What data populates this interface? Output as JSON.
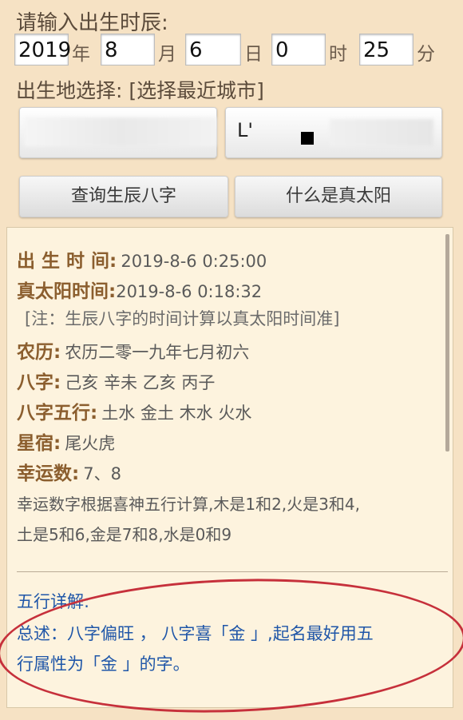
{
  "prompt": "请输入出生时辰:",
  "inputs": {
    "year": {
      "value": "2019",
      "unit": "年"
    },
    "month": {
      "value": "8",
      "unit": "月"
    },
    "day": {
      "value": "6",
      "unit": "日"
    },
    "hour": {
      "value": "0",
      "unit": "时"
    },
    "minute": {
      "value": "25",
      "unit": "分"
    }
  },
  "location": {
    "label": "出生地选择:",
    "link": "[选择最近城市]"
  },
  "selector2_text": "L'",
  "buttons": {
    "query": "查询生辰八字",
    "true_sun": "什么是真太阳"
  },
  "result": {
    "birth_time_label": "出 生 时 间:",
    "birth_time_value": "2019-8-6 0:25:00",
    "true_sun_label": "真太阳时间:",
    "true_sun_value": "2019-8-6 0:18:32",
    "note": "[注：生辰八字的时间计算以真太阳时间准]",
    "lunar_label": "农历:",
    "lunar_value": "农历二零一九年七月初六",
    "bazi_label": "八字:",
    "bazi_value": "己亥 辛未 乙亥 丙子",
    "wuxing_label": "八字五行:",
    "wuxing_value": "土水 金土 木水 火水",
    "xingsu_label": "星宿:",
    "xingsu_value": "尾火虎",
    "lucky_label": "幸运数:",
    "lucky_value": "7、8",
    "lucky_desc_1": "幸运数字根据喜神五行计算,木是1和2,火是3和4,",
    "lucky_desc_2": "土是5和6,金是7和8,水是0和9"
  },
  "detail": {
    "heading": "五行详解:",
    "line1": "总述：八字偏旺 ， 八字喜「金 」,起名最好用五",
    "line2": "行属性为「金 」的字。"
  },
  "colors": {
    "accent_label": "#8b5e2e",
    "detail_blue": "#1f56a8",
    "circle_red": "#c6303b"
  }
}
